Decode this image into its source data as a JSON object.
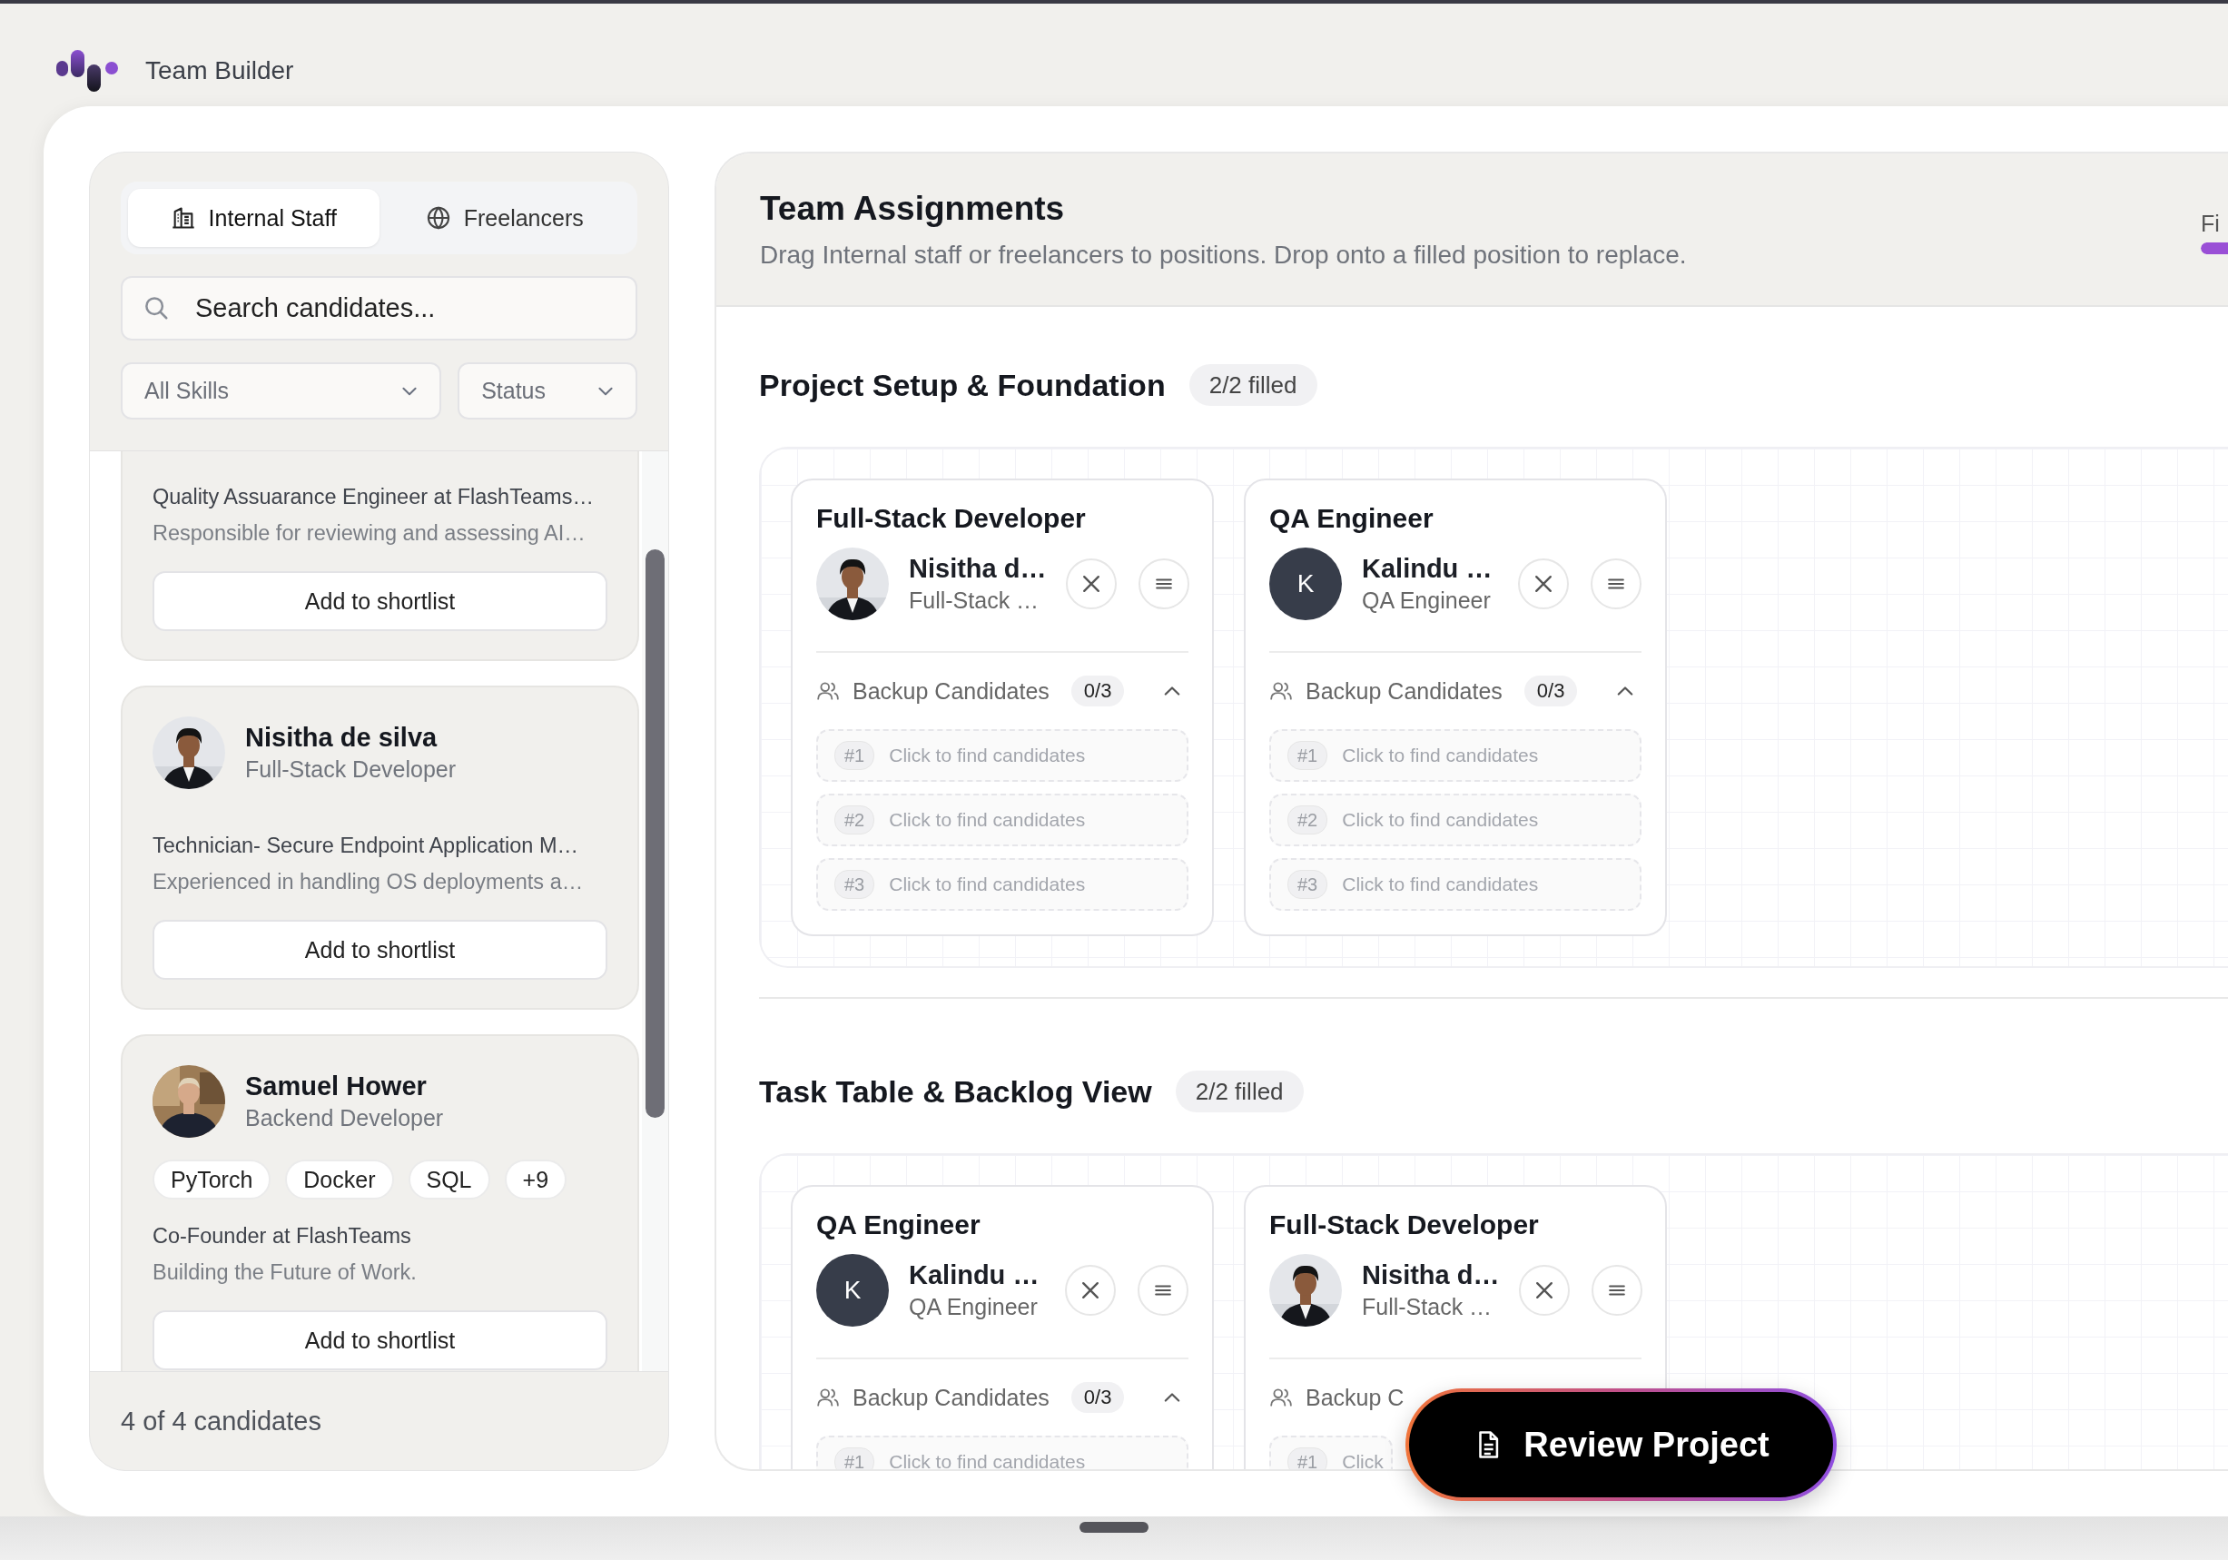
{
  "app": {
    "title": "Team Builder"
  },
  "candidate_panel": {
    "tabs": [
      {
        "label": "Internal Staff",
        "selected": true
      },
      {
        "label": "Freelancers",
        "selected": false
      }
    ],
    "search": {
      "placeholder": "Search candidates..."
    },
    "filters": [
      {
        "value": "All Skills"
      },
      {
        "value": "Status"
      }
    ],
    "candidates": [
      {
        "headline": "Quality Assuarance Engineer at FlashTeams…",
        "about": "Responsible for reviewing and assessing AI…",
        "action": "Add to shortlist"
      },
      {
        "name": "Nisitha de silva",
        "role": "Full-Stack Developer",
        "headline": "Technician- Secure Endpoint Application M…",
        "about": "Experienced in handling OS deployments a…",
        "action": "Add to shortlist"
      },
      {
        "name": "Samuel Hower",
        "role": "Backend Developer",
        "skills": [
          "PyTorch",
          "Docker",
          "SQL",
          "+9"
        ],
        "headline": "Co-Founder at FlashTeams",
        "about": "Building the Future of Work.",
        "action": "Add to shortlist"
      }
    ],
    "footer": "4 of 4 candidates"
  },
  "assignments": {
    "title": "Team Assignments",
    "subtitle": "Drag Internal staff or freelancers to positions. Drop onto a filled position to replace.",
    "progress": {
      "label": "Fi",
      "level": 1
    },
    "sections": [
      {
        "title": "Project Setup & Foundation",
        "badge": "2/2 filled",
        "positions": [
          {
            "role": "Full-Stack Developer",
            "assignee": {
              "name": "Nisitha d…",
              "role": "Full-Stack …"
            },
            "backup": {
              "label": "Backup Candidates",
              "count": "0/3",
              "expanded": true,
              "slots": [
                {
                  "number": "#1",
                  "text": "Click to find candidates"
                },
                {
                  "number": "#2",
                  "text": "Click to find candidates"
                },
                {
                  "number": "#3",
                  "text": "Click to find candidates"
                }
              ]
            }
          },
          {
            "role": "QA Engineer",
            "assignee": {
              "name": "Kalindu …",
              "role": "QA Engineer",
              "avatar": {
                "kind": "initial",
                "initial": "K"
              }
            },
            "backup": {
              "label": "Backup Candidates",
              "count": "0/3",
              "expanded": true,
              "slots": [
                {
                  "number": "#1",
                  "text": "Click to find candidates"
                },
                {
                  "number": "#2",
                  "text": "Click to find candidates"
                },
                {
                  "number": "#3",
                  "text": "Click to find candidates"
                }
              ]
            }
          }
        ]
      },
      {
        "title": "Task Table & Backlog View",
        "badge": "2/2 filled",
        "positions": [
          {
            "role": "QA Engineer",
            "assignee": {
              "name": "Kalindu …",
              "role": "QA Engineer",
              "avatar": {
                "kind": "initial",
                "initial": "K"
              }
            },
            "backup": {
              "label": "Backup Candidates",
              "count": "0/3",
              "expanded": true,
              "slots": [
                {
                  "number": "#1",
                  "text": "Click to find candidates"
                }
              ]
            }
          },
          {
            "role": "Full-Stack Developer",
            "assignee": {
              "name": "Nisitha d…",
              "role": "Full-Stack …"
            },
            "backup": {
              "label": "Backup C",
              "slots": [
                {
                  "number": "#1",
                  "text": "Click"
                }
              ]
            }
          }
        ]
      }
    ]
  },
  "review_button": {
    "label": "Review Project"
  }
}
